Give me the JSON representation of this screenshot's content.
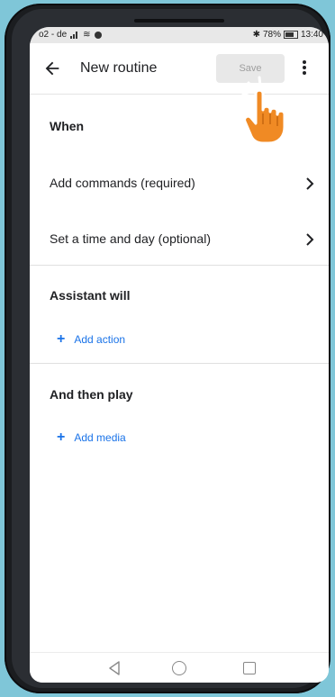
{
  "status_bar": {
    "carrier": "o2 - de",
    "battery": "78%",
    "time": "13:40"
  },
  "app_bar": {
    "title": "New routine",
    "save_label": "Save"
  },
  "sections": {
    "when": {
      "title": "When",
      "rows": [
        {
          "label": "Add commands (required)"
        },
        {
          "label": "Set a time and day (optional)"
        }
      ]
    },
    "assistant": {
      "title": "Assistant will",
      "add_label": "Add action"
    },
    "media": {
      "title": "And then play",
      "add_label": "Add media"
    }
  },
  "colors": {
    "background": "#7fc6d8",
    "accent": "#1a73e8",
    "hand": "#f08a24"
  },
  "icons": [
    "back-arrow-icon",
    "more-vert-icon",
    "chevron-right-icon",
    "plus-icon",
    "hand-pointer-icon",
    "nav-back-icon",
    "nav-home-icon",
    "nav-recents-icon"
  ]
}
